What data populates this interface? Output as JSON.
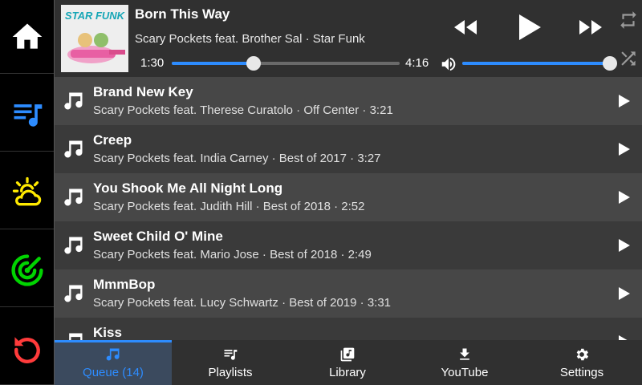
{
  "sidebar": {
    "items": [
      {
        "icon": "home-icon",
        "color": "#ffffff"
      },
      {
        "icon": "playlist-music-icon",
        "color": "#2d8cff"
      },
      {
        "icon": "weather-partly-cloudy-icon",
        "color": "#ffea00"
      },
      {
        "icon": "radar-icon",
        "color": "#00d400"
      },
      {
        "icon": "restart-icon",
        "color": "#ff3b3b"
      }
    ]
  },
  "now_playing": {
    "album_art_text": "STAR FUNK",
    "title": "Born This Way",
    "subtitle": "Scary Pockets feat. Brother Sal · Star Funk",
    "time_current": "1:30",
    "time_total": "4:16",
    "progress_fraction": 0.36,
    "volume_fraction": 1.0
  },
  "queue": [
    {
      "title": "Brand New Key",
      "subtitle": "Scary Pockets feat. Therese Curatolo · Off Center · 3:21"
    },
    {
      "title": "Creep",
      "subtitle": "Scary Pockets feat. India Carney · Best of 2017 · 3:27"
    },
    {
      "title": "You Shook Me All Night Long",
      "subtitle": "Scary Pockets feat. Judith Hill · Best of 2018 · 2:52"
    },
    {
      "title": "Sweet Child O' Mine",
      "subtitle": "Scary Pockets feat. Mario Jose · Best of 2018 · 2:49"
    },
    {
      "title": "MmmBop",
      "subtitle": "Scary Pockets feat. Lucy Schwartz · Best of 2019 · 3:31"
    },
    {
      "title": "Kiss",
      "subtitle": ""
    }
  ],
  "tabs": [
    {
      "label": "Queue (14)",
      "icon": "music-note-icon",
      "active": true
    },
    {
      "label": "Playlists",
      "icon": "playlist-icon",
      "active": false
    },
    {
      "label": "Library",
      "icon": "library-icon",
      "active": false
    },
    {
      "label": "YouTube",
      "icon": "download-icon",
      "active": false
    },
    {
      "label": "Settings",
      "icon": "gear-icon",
      "active": false
    }
  ],
  "colors": {
    "accent": "#2d8cff"
  }
}
